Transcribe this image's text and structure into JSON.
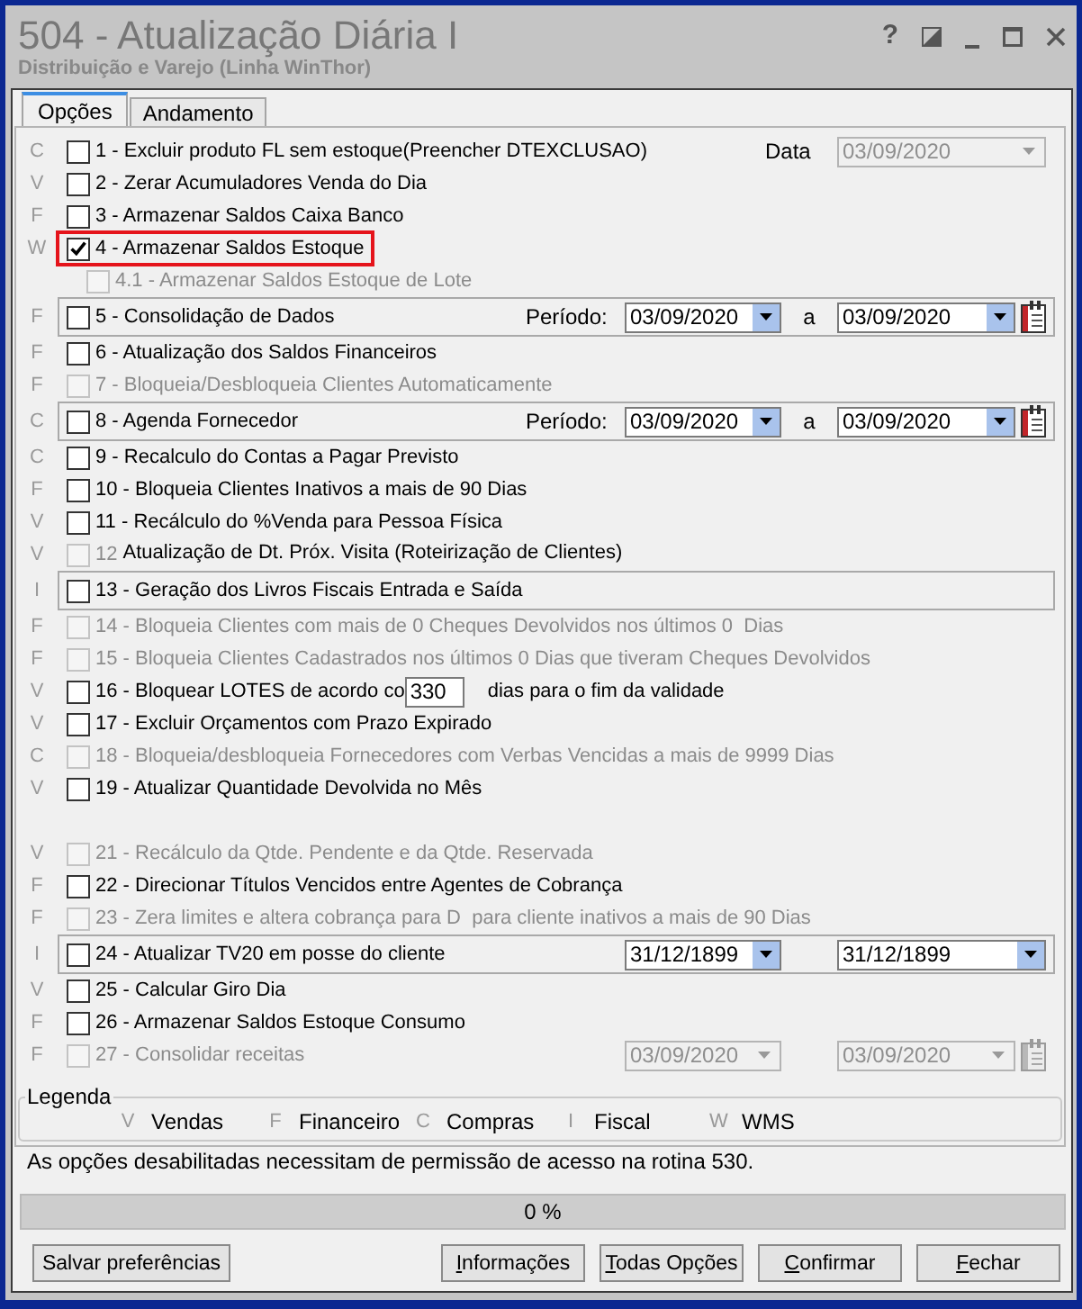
{
  "window": {
    "title": "504 - Atualização Diária I",
    "subtitle": "Distribuição e Varejo (Linha WinThor)",
    "controls": [
      {
        "kind": "help",
        "glyph": "?"
      },
      {
        "kind": "restore"
      },
      {
        "kind": "minimize"
      },
      {
        "kind": "maximize"
      },
      {
        "kind": "close"
      }
    ]
  },
  "tabs": [
    {
      "label": "Opções",
      "selected": true
    },
    {
      "label": "Andamento",
      "selected": false
    }
  ],
  "options": [
    {
      "category": "C",
      "label": "1 - Excluir produto FL sem estoque(Preencher DTEXCLUSAO)",
      "checked": false,
      "disabled": false,
      "extra": {
        "kind": "date",
        "label": "Data",
        "value": "03/09/2020",
        "disabled": true
      }
    },
    {
      "category": "V",
      "label": "2 - Zerar Acumuladores Venda do Dia",
      "checked": false,
      "disabled": false
    },
    {
      "category": "F",
      "label": "3 - Armazenar Saldos Caixa Banco",
      "checked": false,
      "disabled": false
    },
    {
      "category": "W",
      "label": "4 - Armazenar Saldos Estoque",
      "checked": true,
      "disabled": false,
      "highlighted": true,
      "children": [
        {
          "label": "4.1 - Armazenar Saldos Estoque de Lote",
          "checked": false,
          "disabled": true
        }
      ]
    },
    {
      "category": "F",
      "label": "5 - Consolidação de Dados",
      "checked": false,
      "disabled": false,
      "framed": true,
      "extra": {
        "kind": "range",
        "label": "Período:",
        "from": "03/09/2020",
        "separator": "a",
        "to": "03/09/2020",
        "calendar": true,
        "disabled": false
      }
    },
    {
      "category": "F",
      "label": "6 - Atualização dos Saldos Financeiros",
      "checked": false,
      "disabled": false
    },
    {
      "category": "F",
      "label": "7 - Bloqueia/Desbloqueia Clientes Automaticamente",
      "checked": false,
      "disabled": true
    },
    {
      "category": "C",
      "label": "8 - Agenda Fornecedor",
      "checked": false,
      "disabled": false,
      "framed": true,
      "extra": {
        "kind": "range",
        "label": "Período:",
        "from": "03/09/2020",
        "separator": "a",
        "to": "03/09/2020",
        "calendar": true,
        "disabled": false
      }
    },
    {
      "category": "C",
      "label": "9 - Recalculo do Contas a Pagar Previsto",
      "checked": false,
      "disabled": false
    },
    {
      "category": "F",
      "label": "10 - Bloqueia Clientes Inativos a mais de 90 Dias",
      "checked": false,
      "disabled": false
    },
    {
      "category": "V",
      "label": "11 - Recálculo do %Venda para Pessoa Física",
      "checked": false,
      "disabled": false
    },
    {
      "category": "V",
      "label": "12",
      "checked": false,
      "disabled": true,
      "overlay_label": "Atualização de Dt. Próx. Visita (Roteirização de Clientes)"
    },
    {
      "category": "I",
      "label": "13 - Geração dos Livros Fiscais Entrada e Saída",
      "checked": false,
      "disabled": false,
      "framed": true
    },
    {
      "category": "F",
      "label": "14 - Bloqueia Clientes com mais de 0 Cheques Devolvidos nos últimos 0  Dias",
      "checked": false,
      "disabled": true
    },
    {
      "category": "F",
      "label": "15 - Bloqueia Clientes Cadastrados nos últimos 0 Dias que tiveram Cheques Devolvidos",
      "checked": false,
      "disabled": true
    },
    {
      "category": "V",
      "label": "16 - Bloquear LOTES de acordo co",
      "checked": false,
      "disabled": false,
      "extra": {
        "kind": "number",
        "value": "330",
        "suffix": "dias para o fim da validade"
      }
    },
    {
      "category": "V",
      "label": "17 - Excluir Orçamentos com Prazo Expirado",
      "checked": false,
      "disabled": false
    },
    {
      "category": "C",
      "label": "18 - Bloqueia/desbloqueia Fornecedores com Verbas Vencidas a mais de 9999 Dias",
      "checked": false,
      "disabled": true
    },
    {
      "category": "V",
      "label": "19 - Atualizar Quantidade Devolvida no Mês",
      "checked": false,
      "disabled": false
    },
    {
      "category": "V",
      "label": "21 - Recálculo da Qtde. Pendente e da Qtde. Reservada",
      "checked": false,
      "disabled": true
    },
    {
      "category": "F",
      "label": "22 - Direcionar Títulos Vencidos entre Agentes de Cobrança",
      "checked": false,
      "disabled": false
    },
    {
      "category": "F",
      "label": "23 - Zera limites e altera cobrança para D  para cliente inativos a mais de 90 Dias",
      "checked": false,
      "disabled": true
    },
    {
      "category": "I",
      "label": "24 - Atualizar TV20 em posse do cliente",
      "checked": false,
      "disabled": false,
      "framed": true,
      "extra": {
        "kind": "range",
        "from": "31/12/1899",
        "to": "31/12/1899",
        "calendar": false,
        "disabled": false
      }
    },
    {
      "category": "V",
      "label": "25 - Calcular Giro Dia",
      "checked": false,
      "disabled": false
    },
    {
      "category": "F",
      "label": "26 - Armazenar Saldos Estoque Consumo",
      "checked": false,
      "disabled": false
    },
    {
      "category": "F",
      "label": "27 - Consolidar receitas",
      "checked": false,
      "disabled": true,
      "extra": {
        "kind": "range",
        "from": "03/09/2020",
        "to": "03/09/2020",
        "calendar": true,
        "disabled": true
      }
    }
  ],
  "legend": {
    "title": "Legenda",
    "items": [
      {
        "letter": "V",
        "label": "Vendas"
      },
      {
        "letter": "F",
        "label": "Financeiro"
      },
      {
        "letter": "C",
        "label": "Compras"
      },
      {
        "letter": "I",
        "label": "Fiscal"
      },
      {
        "letter": "W",
        "label": "WMS"
      }
    ]
  },
  "notice": "As opções desabilitadas necessitam de permissão de acesso na rotina 530.",
  "progress": {
    "level": 0,
    "text": "0 %"
  },
  "footer": {
    "left_buttons": [
      {
        "label": "Salvar preferências",
        "mnemonic_underlined": false
      }
    ],
    "right_buttons": [
      {
        "label": "Informações",
        "mnemonic_underlined": true
      },
      {
        "label": "Todas Opções",
        "mnemonic_underlined": true
      },
      {
        "label": "Confirmar",
        "mnemonic_underlined": true
      },
      {
        "label": "Fechar",
        "mnemonic_underlined": true
      }
    ]
  }
}
